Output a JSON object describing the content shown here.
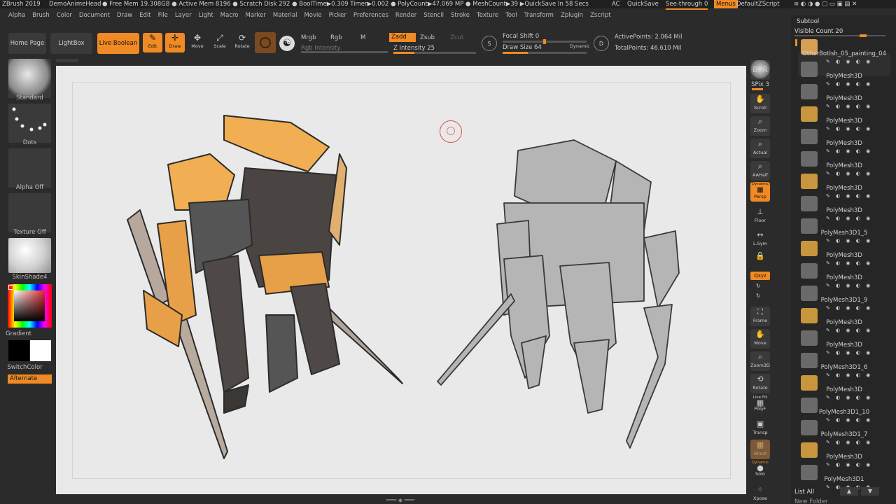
{
  "titlebar": {
    "app": "ZBrush 2019",
    "doc": "DemoAnimeHead",
    "stats": "● Free Mem 19.308GB ● Active Mem 8196 ● Scratch Disk 292 ● BoolTime▶0.309 Timer▶0.002 ● PolyCount▶47.069 MP ● MeshCount▶39 ▶QuickSave In 58 Secs",
    "ac": "AC",
    "quicksave": "QuickSave",
    "see_through": "See-through  0",
    "menus": "Menus",
    "script": "DefaultZScript"
  },
  "menubar": [
    "Alpha",
    "Brush",
    "Color",
    "Document",
    "Draw",
    "Edit",
    "File",
    "Layer",
    "Light",
    "Macro",
    "Marker",
    "Material",
    "Movie",
    "Picker",
    "Preferences",
    "Render",
    "Stencil",
    "Stroke",
    "Texture",
    "Tool",
    "Transform",
    "Zplugin",
    "Zscript"
  ],
  "topshelf": {
    "home": "Home Page",
    "lightbox": "LightBox",
    "live_boolean": "Live Boolean",
    "edit": "Edit",
    "draw": "Draw",
    "move": "Move",
    "scale": "Scale",
    "rotate": "Rotate",
    "mrgb": "Mrgb",
    "rgb": "Rgb",
    "m": "M",
    "zadd": "Zadd",
    "zsub": "Zsub",
    "zcut": "Zcut",
    "rgb_intensity": "Rgb Intensity",
    "z_intensity": "Z Intensity 25",
    "focal_shift": "Focal Shift 0",
    "draw_size": "Draw Size 64",
    "dynamic": "Dynamic",
    "active_points": "ActivePoints: 2.064 Mil",
    "total_points": "TotalPoints: 46.610 Mil",
    "z_intensity_value": 25,
    "focal_shift_value": 0,
    "draw_size_value": 64
  },
  "leftshelf": {
    "standard": "Standard",
    "dots": "Dots",
    "alpha_off": "Alpha Off",
    "texture_off": "Texture Off",
    "skinshade": "SkinShade4",
    "gradient": "Gradient",
    "switch_color": "SwitchColor",
    "alternate": "Alternate"
  },
  "rightshelf": {
    "bpr": "BPR",
    "spix": "SPix 3",
    "scroll": "Scroll",
    "zoom": "Zoom",
    "actual": "Actual",
    "aahalf": "AAHalf",
    "dynamic": "Dynamic",
    "persp": "Persp",
    "floor": "Floor",
    "lsym": "L.Sym",
    "xyz": "Qxyz",
    "frame": "Frame",
    "move": "Move",
    "zoom3d": "Zoom3D",
    "rotate": "Rotate",
    "line_fill": "Line Fill",
    "polyf": "PolyF",
    "transp": "Transp",
    "ghost": "Ghost",
    "solo": "Solo",
    "xpose": "Xpose"
  },
  "subtool": {
    "title": "Subtool",
    "visible_count": "Visible Count 20",
    "items": [
      "OtherBotIsh_05_painting_04",
      "PolyMesh3D",
      "PolyMesh3D",
      "PolyMesh3D",
      "PolyMesh3D",
      "PolyMesh3D",
      "PolyMesh3D",
      "PolyMesh3D",
      "PolyMesh3D1_5",
      "PolyMesh3D",
      "PolyMesh3D",
      "PolyMesh3D1_9",
      "PolyMesh3D",
      "PolyMesh3D",
      "PolyMesh3D1_6",
      "PolyMesh3D",
      "PolyMesh3D1_10",
      "PolyMesh3D1_7",
      "PolyMesh3D",
      "PolyMesh3D1"
    ],
    "list_all": "List All",
    "new_folder": "New Folder"
  },
  "colors": {
    "accent": "#f08a24",
    "canvas": "#e9e9e9",
    "panel": "#2b2b2b"
  }
}
